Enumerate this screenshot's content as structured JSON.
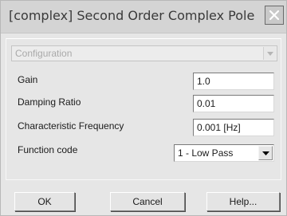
{
  "window": {
    "title": "[complex] Second Order Complex Pole"
  },
  "configuration": {
    "selected": "Configuration"
  },
  "fields": {
    "gain": {
      "label": "Gain",
      "value": "1.0"
    },
    "damping": {
      "label": "Damping Ratio",
      "value": "0.01"
    },
    "frequency": {
      "label": "Characteristic Frequency",
      "value": "0.001 [Hz]"
    },
    "function_code": {
      "label": "Function code",
      "selected": "1 - Low Pass"
    }
  },
  "buttons": {
    "ok": "OK",
    "cancel": "Cancel",
    "help": "Help..."
  },
  "icons": {
    "close": "close-icon",
    "config_arrow": "chevron-down-icon",
    "function_arrow": "chevron-down-icon"
  }
}
